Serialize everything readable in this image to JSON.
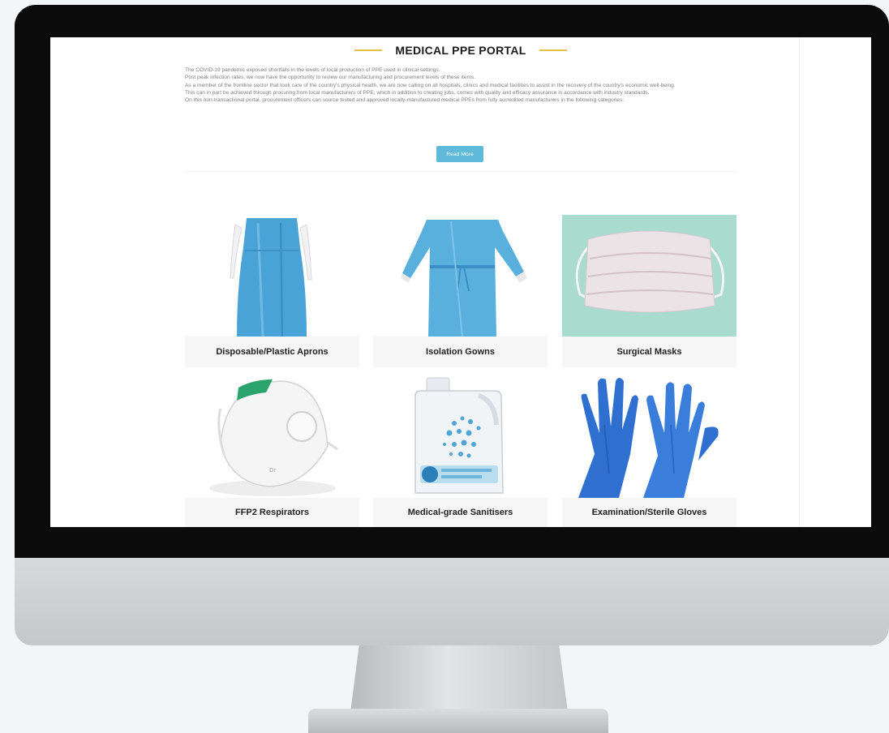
{
  "page": {
    "title": "MEDICAL PPE PORTAL",
    "intro_paragraphs": [
      "The COVID-19 pandemic exposed shortfalls in the levels of local production of PPE used in clinical settings.",
      "Post peak infection rates, we now have the opportunity to review our manufacturing and procurement levels of these items.",
      "As a member of the frontline sector that took care of the country's physical health, we are now calling on all hospitals, clinics and medical facilities to assist in the recovery of the country's economic well-being.",
      "This can in part be achieved through procuring from local manufacturers of PPE, which in addition to creating jobs, comes with quality and efficacy assurance in accordance with industry standards.",
      "On this non-transactional portal, procurement officers can source tested and approved locally-manufactured medical PPEs from fully accredited manufacturers in the following categories:"
    ],
    "read_more_label": "Read More"
  },
  "categories": [
    {
      "label": "Disposable/Plastic Aprons",
      "icon": "apron-image"
    },
    {
      "label": "Isolation Gowns",
      "icon": "gown-image"
    },
    {
      "label": "Surgical Masks",
      "icon": "mask-image"
    },
    {
      "label": "FFP2 Respirators",
      "icon": "respirator-image"
    },
    {
      "label": "Medical-grade Sanitisers",
      "icon": "sanitiser-image"
    },
    {
      "label": "Examination/Sterile Gloves",
      "icon": "gloves-image"
    }
  ],
  "colors": {
    "accent_line": "#e4c24a",
    "button": "#5fb9d8",
    "ppe_blue": "#4aa3d6",
    "glove_blue": "#2f6fd0",
    "mask_bg": "#a9dccf"
  }
}
